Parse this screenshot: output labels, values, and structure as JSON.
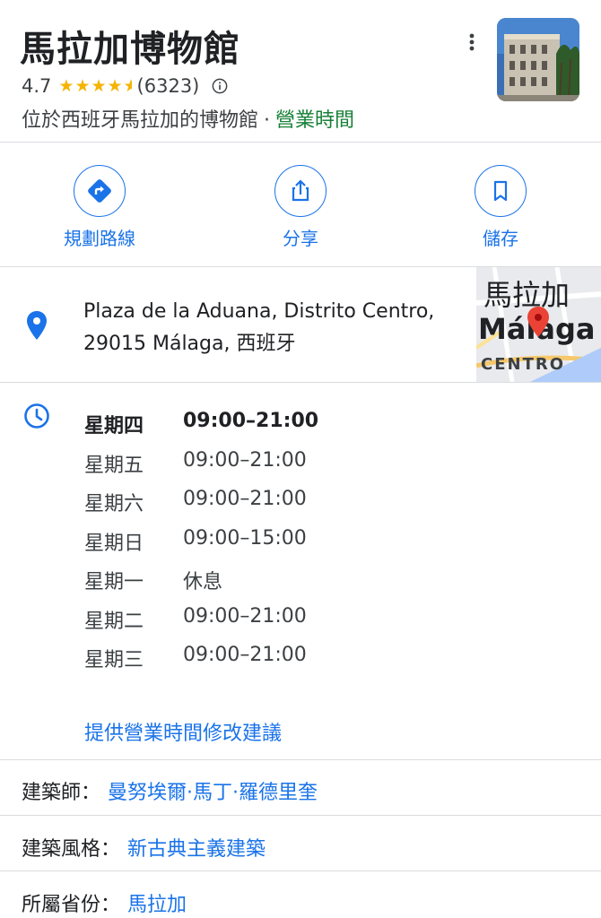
{
  "place": {
    "title": "馬拉加博物館",
    "rating": "4.7",
    "review_count": "(6323)",
    "category": "位於西班牙馬拉加的博物館",
    "separator": "·",
    "hours_link": "營業時間"
  },
  "actions": [
    {
      "label": "規劃路線",
      "icon": "directions-icon"
    },
    {
      "label": "分享",
      "icon": "share-icon"
    },
    {
      "label": "儲存",
      "icon": "bookmark-icon"
    }
  ],
  "address": {
    "line1": "Plaza de la Aduana, Distrito Centro,",
    "line2": "29015 Málaga, 西班牙"
  },
  "map_thumb": {
    "label_top": "馬拉加",
    "label_city": "Málaga",
    "label_district": "CENTRO"
  },
  "hours": [
    {
      "day": "星期四",
      "time": "09:00–21:00",
      "today": true
    },
    {
      "day": "星期五",
      "time": "09:00–21:00"
    },
    {
      "day": "星期六",
      "time": "09:00–21:00"
    },
    {
      "day": "星期日",
      "time": "09:00–15:00"
    },
    {
      "day": "星期一",
      "time": "休息"
    },
    {
      "day": "星期二",
      "time": "09:00–21:00"
    },
    {
      "day": "星期三",
      "time": "09:00–21:00"
    }
  ],
  "suggest_edit": "提供營業時間修改建議",
  "facts": [
    {
      "label": "建築師：",
      "value": "曼努埃爾·馬丁·羅德里奎"
    },
    {
      "label": "建築風格：",
      "value": "新古典主義建築"
    },
    {
      "label": "所屬省份：",
      "value": "馬拉加"
    }
  ],
  "colors": {
    "accent": "#1a73e8",
    "open_green": "#188038",
    "star": "#f4b400",
    "pin_red": "#ea4335"
  }
}
